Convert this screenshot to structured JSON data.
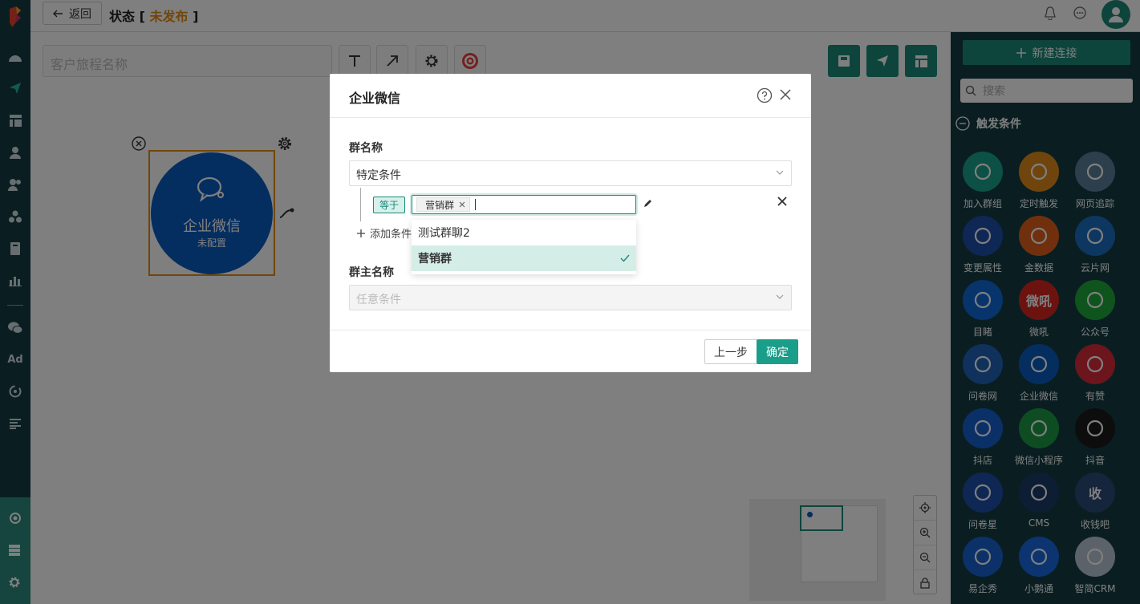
{
  "header": {
    "back_label": "返回",
    "status_prefix": "状态 [",
    "status_value": "未发布",
    "status_suffix": "]"
  },
  "nav": {
    "ad_label": "Ad"
  },
  "canvas": {
    "journey_name_placeholder": "客户旅程名称",
    "node": {
      "title": "企业微信",
      "subtitle": "未配置"
    }
  },
  "right_panel": {
    "new_connection_label": "新建连接",
    "search_placeholder": "搜索",
    "section_title": "触发条件",
    "items": [
      {
        "label": "加入群组",
        "icon": "user-add-icon",
        "color": "#18a08d"
      },
      {
        "label": "定时触发",
        "icon": "clock-icon",
        "color": "#e08a1a"
      },
      {
        "label": "网页追踪",
        "icon": "webpage-icon",
        "color": "#5a7f9a"
      },
      {
        "label": "变更属性",
        "icon": "edit-icon",
        "color": "#1f4fa8"
      },
      {
        "label": "金数据",
        "icon": "jinshuju-icon",
        "color": "#e0601a"
      },
      {
        "label": "云片网",
        "icon": "yunpian-icon",
        "color": "#1a6fc0"
      },
      {
        "label": "目睹",
        "icon": "play-icon",
        "color": "#1068d8"
      },
      {
        "label": "微吼",
        "icon": "vhall-icon",
        "color": "#d8261f",
        "text": "微吼"
      },
      {
        "label": "公众号",
        "icon": "wechat-icon",
        "color": "#1ea83a"
      },
      {
        "label": "问卷网",
        "icon": "wenjuan-icon",
        "color": "#1f62b8"
      },
      {
        "label": "企业微信",
        "icon": "wecom-icon",
        "color": "#0b5cc0"
      },
      {
        "label": "有赞",
        "icon": "youzan-icon",
        "color": "#d82a38"
      },
      {
        "label": "抖店",
        "icon": "doudian-icon",
        "color": "#1760d0"
      },
      {
        "label": "微信小程序",
        "icon": "miniprogram-icon",
        "color": "#1d9a45"
      },
      {
        "label": "抖音",
        "icon": "douyin-icon",
        "color": "#1a1a1a"
      },
      {
        "label": "问卷星",
        "icon": "star-icon",
        "color": "#1d4ea8"
      },
      {
        "label": "CMS",
        "icon": "cms-icon",
        "color": "#1a3a66"
      },
      {
        "label": "收钱吧",
        "icon": "shouqianba-icon",
        "color": "#2a4a78",
        "text": "收"
      },
      {
        "label": "易企秀",
        "icon": "eqxiu-icon",
        "color": "#1763d0"
      },
      {
        "label": "小鹅通",
        "icon": "xiaoetong-icon",
        "color": "#1768e0"
      },
      {
        "label": "智简CRM",
        "icon": "crm-icon",
        "color": "#b8c4d4"
      }
    ]
  },
  "modal": {
    "title": "企业微信",
    "group_name_label": "群名称",
    "group_name_select": "特定条件",
    "operator_tag": "等于",
    "selected_chip": "营销群",
    "add_condition_label": "添加条件",
    "dropdown_options": [
      {
        "label": "测试群聊2",
        "selected": false
      },
      {
        "label": "营销群",
        "selected": true
      }
    ],
    "owner_label": "群主名称",
    "owner_select": "任意条件",
    "prev_button": "上一步",
    "confirm_button": "确定"
  }
}
